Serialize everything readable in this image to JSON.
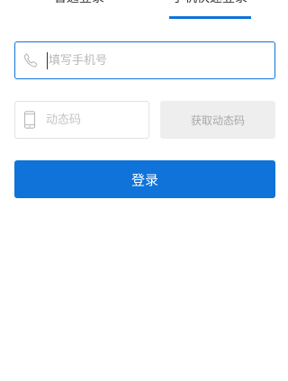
{
  "tabs": {
    "normal_login": "普通登录",
    "phone_login": "手机快速登录",
    "active": "phone_login"
  },
  "form": {
    "phone_placeholder": "填写手机号",
    "phone_value": "",
    "code_placeholder": "动态码",
    "code_value": "",
    "get_code_label": "获取动态码",
    "login_label": "登录"
  },
  "colors": {
    "accent": "#0f73d9",
    "disabled_bg": "#eeeeee",
    "disabled_text": "#a8a8a8"
  },
  "icons": {
    "phone_field": "phone-handset-icon",
    "code_field": "mobile-device-icon"
  }
}
